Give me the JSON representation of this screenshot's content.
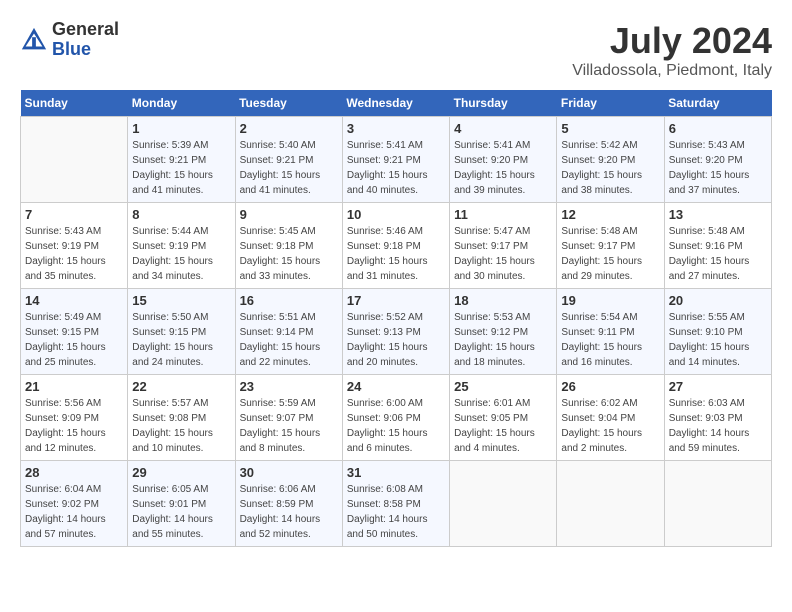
{
  "header": {
    "logo_general": "General",
    "logo_blue": "Blue",
    "month_year": "July 2024",
    "location": "Villadossola, Piedmont, Italy"
  },
  "calendar": {
    "days_of_week": [
      "Sunday",
      "Monday",
      "Tuesday",
      "Wednesday",
      "Thursday",
      "Friday",
      "Saturday"
    ],
    "weeks": [
      [
        {
          "day": "",
          "sunrise": "",
          "sunset": "",
          "daylight": ""
        },
        {
          "day": "1",
          "sunrise": "Sunrise: 5:39 AM",
          "sunset": "Sunset: 9:21 PM",
          "daylight": "Daylight: 15 hours and 41 minutes."
        },
        {
          "day": "2",
          "sunrise": "Sunrise: 5:40 AM",
          "sunset": "Sunset: 9:21 PM",
          "daylight": "Daylight: 15 hours and 41 minutes."
        },
        {
          "day": "3",
          "sunrise": "Sunrise: 5:41 AM",
          "sunset": "Sunset: 9:21 PM",
          "daylight": "Daylight: 15 hours and 40 minutes."
        },
        {
          "day": "4",
          "sunrise": "Sunrise: 5:41 AM",
          "sunset": "Sunset: 9:20 PM",
          "daylight": "Daylight: 15 hours and 39 minutes."
        },
        {
          "day": "5",
          "sunrise": "Sunrise: 5:42 AM",
          "sunset": "Sunset: 9:20 PM",
          "daylight": "Daylight: 15 hours and 38 minutes."
        },
        {
          "day": "6",
          "sunrise": "Sunrise: 5:43 AM",
          "sunset": "Sunset: 9:20 PM",
          "daylight": "Daylight: 15 hours and 37 minutes."
        }
      ],
      [
        {
          "day": "7",
          "sunrise": "Sunrise: 5:43 AM",
          "sunset": "Sunset: 9:19 PM",
          "daylight": "Daylight: 15 hours and 35 minutes."
        },
        {
          "day": "8",
          "sunrise": "Sunrise: 5:44 AM",
          "sunset": "Sunset: 9:19 PM",
          "daylight": "Daylight: 15 hours and 34 minutes."
        },
        {
          "day": "9",
          "sunrise": "Sunrise: 5:45 AM",
          "sunset": "Sunset: 9:18 PM",
          "daylight": "Daylight: 15 hours and 33 minutes."
        },
        {
          "day": "10",
          "sunrise": "Sunrise: 5:46 AM",
          "sunset": "Sunset: 9:18 PM",
          "daylight": "Daylight: 15 hours and 31 minutes."
        },
        {
          "day": "11",
          "sunrise": "Sunrise: 5:47 AM",
          "sunset": "Sunset: 9:17 PM",
          "daylight": "Daylight: 15 hours and 30 minutes."
        },
        {
          "day": "12",
          "sunrise": "Sunrise: 5:48 AM",
          "sunset": "Sunset: 9:17 PM",
          "daylight": "Daylight: 15 hours and 29 minutes."
        },
        {
          "day": "13",
          "sunrise": "Sunrise: 5:48 AM",
          "sunset": "Sunset: 9:16 PM",
          "daylight": "Daylight: 15 hours and 27 minutes."
        }
      ],
      [
        {
          "day": "14",
          "sunrise": "Sunrise: 5:49 AM",
          "sunset": "Sunset: 9:15 PM",
          "daylight": "Daylight: 15 hours and 25 minutes."
        },
        {
          "day": "15",
          "sunrise": "Sunrise: 5:50 AM",
          "sunset": "Sunset: 9:15 PM",
          "daylight": "Daylight: 15 hours and 24 minutes."
        },
        {
          "day": "16",
          "sunrise": "Sunrise: 5:51 AM",
          "sunset": "Sunset: 9:14 PM",
          "daylight": "Daylight: 15 hours and 22 minutes."
        },
        {
          "day": "17",
          "sunrise": "Sunrise: 5:52 AM",
          "sunset": "Sunset: 9:13 PM",
          "daylight": "Daylight: 15 hours and 20 minutes."
        },
        {
          "day": "18",
          "sunrise": "Sunrise: 5:53 AM",
          "sunset": "Sunset: 9:12 PM",
          "daylight": "Daylight: 15 hours and 18 minutes."
        },
        {
          "day": "19",
          "sunrise": "Sunrise: 5:54 AM",
          "sunset": "Sunset: 9:11 PM",
          "daylight": "Daylight: 15 hours and 16 minutes."
        },
        {
          "day": "20",
          "sunrise": "Sunrise: 5:55 AM",
          "sunset": "Sunset: 9:10 PM",
          "daylight": "Daylight: 15 hours and 14 minutes."
        }
      ],
      [
        {
          "day": "21",
          "sunrise": "Sunrise: 5:56 AM",
          "sunset": "Sunset: 9:09 PM",
          "daylight": "Daylight: 15 hours and 12 minutes."
        },
        {
          "day": "22",
          "sunrise": "Sunrise: 5:57 AM",
          "sunset": "Sunset: 9:08 PM",
          "daylight": "Daylight: 15 hours and 10 minutes."
        },
        {
          "day": "23",
          "sunrise": "Sunrise: 5:59 AM",
          "sunset": "Sunset: 9:07 PM",
          "daylight": "Daylight: 15 hours and 8 minutes."
        },
        {
          "day": "24",
          "sunrise": "Sunrise: 6:00 AM",
          "sunset": "Sunset: 9:06 PM",
          "daylight": "Daylight: 15 hours and 6 minutes."
        },
        {
          "day": "25",
          "sunrise": "Sunrise: 6:01 AM",
          "sunset": "Sunset: 9:05 PM",
          "daylight": "Daylight: 15 hours and 4 minutes."
        },
        {
          "day": "26",
          "sunrise": "Sunrise: 6:02 AM",
          "sunset": "Sunset: 9:04 PM",
          "daylight": "Daylight: 15 hours and 2 minutes."
        },
        {
          "day": "27",
          "sunrise": "Sunrise: 6:03 AM",
          "sunset": "Sunset: 9:03 PM",
          "daylight": "Daylight: 14 hours and 59 minutes."
        }
      ],
      [
        {
          "day": "28",
          "sunrise": "Sunrise: 6:04 AM",
          "sunset": "Sunset: 9:02 PM",
          "daylight": "Daylight: 14 hours and 57 minutes."
        },
        {
          "day": "29",
          "sunrise": "Sunrise: 6:05 AM",
          "sunset": "Sunset: 9:01 PM",
          "daylight": "Daylight: 14 hours and 55 minutes."
        },
        {
          "day": "30",
          "sunrise": "Sunrise: 6:06 AM",
          "sunset": "Sunset: 8:59 PM",
          "daylight": "Daylight: 14 hours and 52 minutes."
        },
        {
          "day": "31",
          "sunrise": "Sunrise: 6:08 AM",
          "sunset": "Sunset: 8:58 PM",
          "daylight": "Daylight: 14 hours and 50 minutes."
        },
        {
          "day": "",
          "sunrise": "",
          "sunset": "",
          "daylight": ""
        },
        {
          "day": "",
          "sunrise": "",
          "sunset": "",
          "daylight": ""
        },
        {
          "day": "",
          "sunrise": "",
          "sunset": "",
          "daylight": ""
        }
      ]
    ]
  }
}
